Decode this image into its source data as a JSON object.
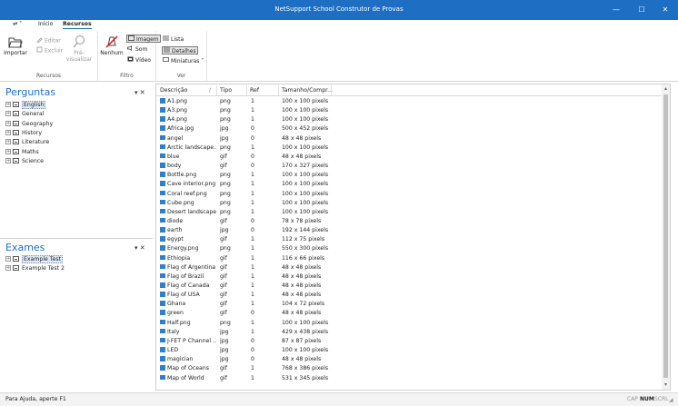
{
  "window": {
    "title": "NetSupport School Construtor de Provas",
    "minimize": "—",
    "maximize": "☐",
    "close": "✕"
  },
  "menu": {
    "quick": "⇄ ˅",
    "items": [
      "Início",
      "Recursos"
    ]
  },
  "ribbon": {
    "groups": [
      {
        "label": "Recursos",
        "buttons": [
          "Importar",
          "Editar",
          "Excluir",
          "Pré-visualizar"
        ]
      },
      {
        "label": "Filtro",
        "buttons": [
          "Nenhum",
          "Imagem",
          "Som",
          "Vídeo"
        ]
      },
      {
        "label": "Ver",
        "buttons": [
          "Lista",
          "Detalhes",
          "Miniaturas"
        ]
      }
    ]
  },
  "perguntas": {
    "title": "Perguntas",
    "tools": "▾ ✕",
    "items": [
      "English",
      "General",
      "Geography",
      "History",
      "Literature",
      "Maths",
      "Science"
    ]
  },
  "exames": {
    "title": "Exames",
    "tools": "▾ ✕",
    "items": [
      "Example Test",
      "Example Test 2"
    ]
  },
  "grid": {
    "columns": [
      "Descrição",
      "Tipo",
      "Ref",
      "Tamanho/Compr..."
    ],
    "sort_indicator": "/",
    "rows": [
      [
        "A1.png",
        "png",
        "1",
        "100 x 100 pixels"
      ],
      [
        "A3.png",
        "png",
        "1",
        "100 x 100 pixels"
      ],
      [
        "A4.png",
        "png",
        "1",
        "100 x 100 pixels"
      ],
      [
        "Africa.jpg",
        "jpg",
        "0",
        "500 x 452 pixels"
      ],
      [
        "angel",
        "jpg",
        "0",
        "48 x 48 pixels"
      ],
      [
        "Arctic landscape....",
        "png",
        "1",
        "100 x 100 pixels"
      ],
      [
        "blue",
        "gif",
        "0",
        "48 x 48 pixels"
      ],
      [
        "body",
        "gif",
        "0",
        "170 x 327 pixels"
      ],
      [
        "Bottle.png",
        "png",
        "1",
        "100 x 100 pixels"
      ],
      [
        "Cave interior.png",
        "png",
        "1",
        "100 x 100 pixels"
      ],
      [
        "Coral reef.png",
        "png",
        "1",
        "100 x 100 pixels"
      ],
      [
        "Cube.png",
        "png",
        "1",
        "100 x 100 pixels"
      ],
      [
        "Desert landscape....",
        "png",
        "1",
        "100 x 100 pixels"
      ],
      [
        "diode",
        "gif",
        "0",
        "78 x 78 pixels"
      ],
      [
        "earth",
        "jpg",
        "0",
        "192 x 144 pixels"
      ],
      [
        "egypt",
        "gif",
        "1",
        "112 x 75 pixels"
      ],
      [
        "Energy.png",
        "png",
        "1",
        "550 x 300 pixels"
      ],
      [
        "Ethiopia",
        "gif",
        "1",
        "116 x 66 pixels"
      ],
      [
        "Flag of Argentina",
        "gif",
        "1",
        "48 x 48 pixels"
      ],
      [
        "Flag of Brazil",
        "gif",
        "1",
        "48 x 48 pixels"
      ],
      [
        "Flag of Canada",
        "gif",
        "1",
        "48 x 48 pixels"
      ],
      [
        "Flag of USA",
        "gif",
        "1",
        "48 x 48 pixels"
      ],
      [
        "Ghana",
        "gif",
        "1",
        "104 x 72 pixels"
      ],
      [
        "green",
        "gif",
        "0",
        "48 x 48 pixels"
      ],
      [
        "Half.png",
        "png",
        "1",
        "100 x 100 pixels"
      ],
      [
        "Italy",
        "jpg",
        "1",
        "429 x 438 pixels"
      ],
      [
        "J-FET P Channel ...",
        "jpg",
        "0",
        "87 x 87 pixels"
      ],
      [
        "LED",
        "jpg",
        "0",
        "100 x 100 pixels"
      ],
      [
        "magician",
        "jpg",
        "0",
        "48 x 48 pixels"
      ],
      [
        "Map of Oceans",
        "gif",
        "1",
        "768 x 386 pixels"
      ],
      [
        "Map of World",
        "gif",
        "1",
        "531 x 345 pixels"
      ]
    ]
  },
  "scrollbar": {
    "up": "▴",
    "down": "▾"
  },
  "status": {
    "help": "Para Ajuda, aperte F1",
    "indicators": [
      "CAP",
      "NUM",
      "SCRL"
    ],
    "active": "NUM"
  },
  "colors": {
    "accent": "#1e6ec4",
    "title_bar": "#1e6ec4",
    "file_icon": "#2f7fc9"
  }
}
